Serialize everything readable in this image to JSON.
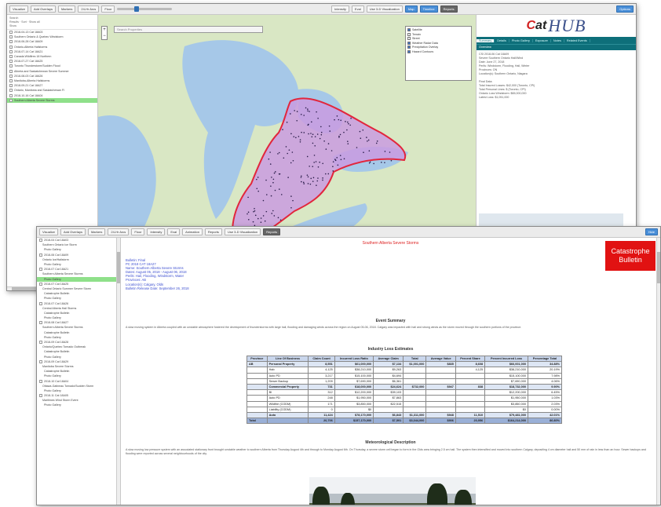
{
  "back_window": {
    "toolbar": {
      "buttons": [
        "Visualize",
        "Add Overlays",
        "Markers",
        "24-Hr Arcs",
        "Floor"
      ],
      "right_buttons": [
        "Intensity",
        "Eval"
      ],
      "checkbox_label": "Use 3-D Visualization",
      "action_buttons": [
        "Map",
        "Timeline",
        "Reports"
      ],
      "end_button": "Options"
    },
    "sidebar": {
      "header": [
        "Search",
        "Results · Sort · Show all",
        "Show"
      ],
      "items": [
        "2018-04-13 Cat 18A03",
        "Southern Ontario & Quebec Windstorm",
        "2018-06-28 Cat 18A09",
        "Ontario-Alberta Hailstorms",
        "2018-07-14 Cat 18A21",
        "Canada Wildfires 18 Northern",
        "2018-07-27 Cat 18A25",
        "Toronto Thunderstorm/Sudden Flood",
        "Alberta and Saskatchewan Severe Summer",
        "2018-08-03 Cat 18A26",
        "Manitoba-Alberta Hailstorms",
        "2018-09-21 Cat 18A27",
        "Ontario, Manitoba and Saskatchewan Fl",
        "2018-10-16 Cat 18A04",
        "Southern Alberta Severe Storms"
      ],
      "selected_index": 14
    },
    "map": {
      "search_placeholder": "Search Properties",
      "zoom_in": "+",
      "zoom_out": "−",
      "layers": [
        {
          "label": "Satellite",
          "on": true
        },
        {
          "label": "Terrain",
          "on": false
        },
        {
          "label": "Street",
          "on": false
        },
        {
          "label": "Weather Radar Data",
          "on": true
        },
        {
          "label": "Precipitation Overlay",
          "on": true
        },
        {
          "label": "Hazard Contours",
          "on": true
        }
      ],
      "colors": {
        "water": "#a6c8e8",
        "land": "#d9e7c4",
        "footprint": "#c99be0",
        "boundary": "#e2263c"
      }
    },
    "right_panel": {
      "logo_cat": "Cat",
      "logo_hub": "HUB",
      "tabs": [
        "Summary",
        "Details",
        "Photo Gallery",
        "Exposure",
        "Notes",
        "Related Events"
      ],
      "active_tab": 0,
      "subtab": "Overview",
      "info_lines": [
        "CSI 2018-06 Cat 18A09",
        "Severe Southern Ontario Hail/Wind",
        "Date: June 27, 2018",
        "Perils: Windstorm, Flooding, Hail, Winter",
        "Provinces: ON",
        "Location(s): Southern Ontario, Niagara",
        "",
        "Final Data:",
        "Total Insured Losses: $42,000 (Toronto, CPI)",
        "Total Personal Lines: $ (Toronto, CPI)",
        "Ontario Loss Windstorm: $65,000,000",
        "Latest Loss: $1,051,000"
      ]
    }
  },
  "front_window": {
    "toolbar": {
      "buttons": [
        "Visualize",
        "Add Overlays",
        "Markers",
        "24-Hr Arcs",
        "Floor",
        "Intensity",
        "Eval",
        "Animation",
        "Reports"
      ],
      "checkbox_label": "Use 3-D Visualization",
      "end_button": "Reports",
      "corner_button": "Hide"
    },
    "sidebar": {
      "items": [
        {
          "text": "2018-04 Cat 18A03",
          "level": 0
        },
        {
          "text": "Southern Ontario Ice Storm",
          "level": 1
        },
        {
          "text": "Photo Gallery",
          "level": 2
        },
        {
          "text": "2018-06 Cat 18A09",
          "level": 0
        },
        {
          "text": "Ontario Ice/Hailstorm",
          "level": 1
        },
        {
          "text": "Photo Gallery",
          "level": 2
        },
        {
          "text": "2018-07 Cat 18A21",
          "level": 0
        },
        {
          "text": "Southern Alberta Severe Storms",
          "level": 1
        },
        {
          "text": "Photo Gallery",
          "level": 2
        },
        {
          "text": "2018-07 Cat 18A25",
          "level": 0
        },
        {
          "text": "Central Ontario Summer Severe Storm",
          "level": 1
        },
        {
          "text": "Catastrophe Bulletin",
          "level": 2
        },
        {
          "text": "Photo Gallery",
          "level": 2
        },
        {
          "text": "2018-07 Cat 18A26",
          "level": 0
        },
        {
          "text": "Central Alberta Hail Storms",
          "level": 1
        },
        {
          "text": "Catastrophe Bulletin",
          "level": 2
        },
        {
          "text": "Photo Gallery",
          "level": 2
        },
        {
          "text": "2018-08 Cat 18A27",
          "level": 0
        },
        {
          "text": "Southern Alberta Severe Storms",
          "level": 1
        },
        {
          "text": "Catastrophe Bulletin",
          "level": 2
        },
        {
          "text": "Photo Gallery",
          "level": 2
        },
        {
          "text": "2018-09 Cat 18A28",
          "level": 0
        },
        {
          "text": "Ontario/Quebec Tornado Outbreak",
          "level": 1
        },
        {
          "text": "Catastrophe Bulletin",
          "level": 2
        },
        {
          "text": "Photo Gallery",
          "level": 2
        },
        {
          "text": "2018-09 Cat 18A29",
          "level": 0
        },
        {
          "text": "Manitoba Severe Storms",
          "level": 1
        },
        {
          "text": "Catastrophe Bulletin",
          "level": 2
        },
        {
          "text": "Photo Gallery",
          "level": 2
        },
        {
          "text": "2018-10 Cat 18A04",
          "level": 0
        },
        {
          "text": "Ottawa-Gatineau Tornado/Sudden Storm",
          "level": 1
        },
        {
          "text": "Photo Gallery",
          "level": 2
        },
        {
          "text": "2018-11 Cat 18A05",
          "level": 0
        },
        {
          "text": "Maritimes Wind Storm Event",
          "level": 1
        },
        {
          "text": "Photo Gallery",
          "level": 2
        }
      ],
      "selected_index": 8
    },
    "report": {
      "title": "Southern Alberta Severe Storms",
      "badge_line1": "Catastrophe",
      "badge_line2": "Bulletin",
      "meta_lines": [
        "Bulletin: Final",
        "PC 2018 CAT 18A27",
        "Name: Southern Alberta Severe Storms",
        "Dates: August 05, 2018 - August 06, 2018",
        "Perils: Hail, Flooding, Windstorm, Water",
        "Provinces: AB",
        "Location(s): Calgary, Olds",
        "Bulletin Release Date: September 26, 2018"
      ],
      "event_summary_heading": "Event Summary",
      "event_summary_text": "A slow moving system in Alberta coupled with an unstable atmosphere fostered the development of thunderstorms with large hail, flooding and damaging winds across the region on August 05-06, 2018. Calgary was impacted with hail and strong winds as the storm moved through the southern portions of the province.",
      "loss_heading": "Industry Loss Estimates",
      "table": {
        "headers": [
          "Province",
          "Line Of Business",
          "Claim Count",
          "Incurred Loss Ratio",
          "Average Claim",
          "Total",
          "Average Value",
          "Percent Share",
          "Percent Incurred Loss",
          "Percentage Total"
        ],
        "rows": [
          {
            "cells": [
              "AB",
              "Personal Property",
              "8,551",
              "$61,000,000",
              "$7,134",
              "$1,001,000",
              "$835",
              "8,608",
              "$66,001,000",
              "34.88%"
            ],
            "hl": true
          },
          {
            "cells": [
              "",
              "Hab",
              "4,125",
              "$38,210,000",
              "$9,263",
              "",
              "",
              "4,125",
              "$38,210,000",
              "20.19%"
            ],
            "hl": false
          },
          {
            "cells": [
              "",
              "Auto PD",
              "3,217",
              "$15,100,000",
              "$4,694",
              "",
              "",
              "",
              "$15,100,000",
              "7.98%"
            ],
            "hl": false
          },
          {
            "cells": [
              "",
              "Sewer Backup",
              "1,209",
              "$7,690,000",
              "$6,361",
              "",
              "",
              "",
              "$7,690,000",
              "4.06%"
            ],
            "hl": false
          },
          {
            "cells": [
              "",
              "Commercial Property",
              "731",
              "$18,000,000",
              "$24,624",
              "$732,000",
              "$947",
              "838",
              "$18,732,000",
              "9.90%"
            ],
            "hl": true
          },
          {
            "cells": [
              "",
              "BI",
              "312",
              "$12,200,000",
              "$39,103",
              "",
              "",
              "",
              "$12,200,000",
              "6.45%"
            ],
            "hl": false
          },
          {
            "cells": [
              "",
              "Auto PD",
              "248",
              "$1,950,000",
              "$7,863",
              "",
              "",
              "",
              "$1,950,000",
              "1.03%"
            ],
            "hl": false
          },
          {
            "cells": [
              "",
              "Wildfire (CODM)",
              "171",
              "$3,850,000",
              "$22,515",
              "",
              "",
              "",
              "$3,850,000",
              "2.03%"
            ],
            "hl": false
          },
          {
            "cells": [
              "",
              "Liability (CODM)",
              "0",
              "$0",
              "",
              "",
              "",
              "",
              "$0",
              "0.00%"
            ],
            "hl": false
          },
          {
            "cells": [
              "",
              "Auto",
              "11,424",
              "$78,170,000",
              "$6,843",
              "$1,311,000",
              "$948",
              "11,510",
              "$79,481,000",
              "42.01%"
            ],
            "hl": true
          },
          {
            "cells": [
              "Total",
              "",
              "20,706",
              "$157,170,000",
              "$7,591",
              "$3,044,000",
              "$906",
              "20,956",
              "$164,214,000",
              "86.80%"
            ],
            "tot": true
          }
        ]
      },
      "met_heading": "Meteorological Description",
      "met_text": "A slow moving low pressure system with an associated stationary front brought unstable weather to southern Alberta from Thursday August 4th and through to Monday August 6th. On Thursday, a severe storm cell began to form in the Olds area bringing 2.5 cm hail. The system then intensified and moved into southern Calgary, depositing 4 cm diameter hail and 50 mm of rain in less than an hour. Sewer backups and flooding were reported across several neighbourhoods of the city."
    }
  }
}
